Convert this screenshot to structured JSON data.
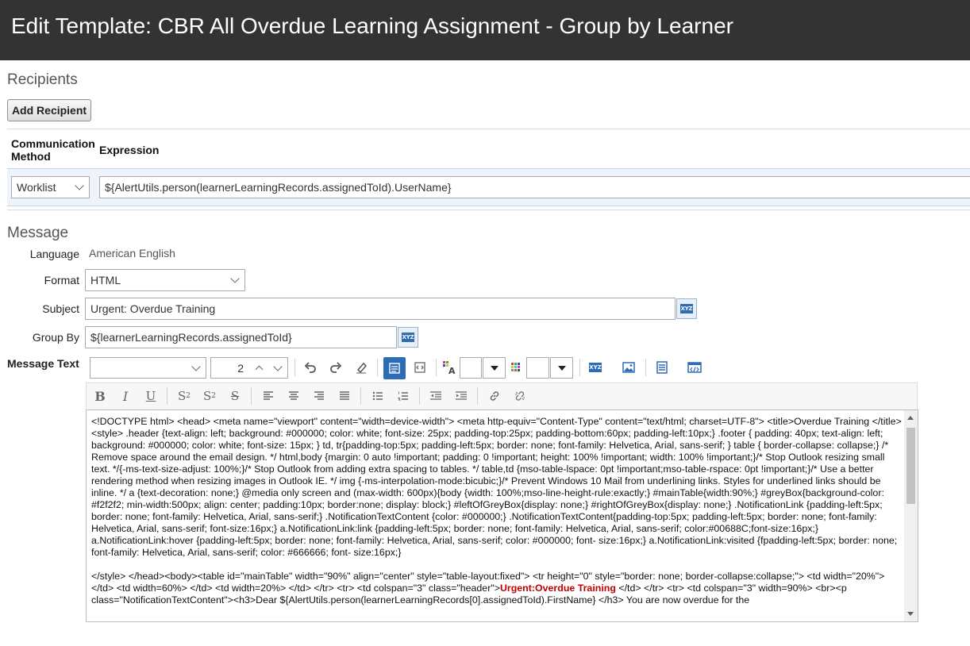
{
  "window": {
    "title": "Edit Template: CBR All Overdue Learning Assignment - Group by Learner"
  },
  "recipients": {
    "section_title": "Recipients",
    "add_button": "Add Recipient",
    "columns": {
      "method_line1": "Communication",
      "method_line2": "Method",
      "expression": "Expression"
    },
    "row": {
      "method": "Worklist",
      "expression": "${AlertUtils.person(learnerLearningRecords.assignedToId).UserName}"
    }
  },
  "message": {
    "section_title": "Message",
    "language_label": "Language",
    "language_value": "American English",
    "format_label": "Format",
    "format_value": "HTML",
    "subject_label": "Subject",
    "subject_value": "Urgent: Overdue Training",
    "groupby_label": "Group By",
    "groupby_value": "${learnerLearningRecords.assignedToId}",
    "message_text_label": "Message Text",
    "font_size_value": "2",
    "xyz_icon_text": "XYZ",
    "body_paragraph1": "<!DOCTYPE html> <head> <meta name=\"viewport\" content=\"width=device-width\"> <meta http-equiv=\"Content-Type\" content=\"text/html; charset=UTF-8\"> <title>Overdue Training </title> <style> .header {text-align: left; background: #000000; color: white; font-size: 25px; padding-top:25px; padding-bottom:60px; padding-left:10px;} .footer { padding: 40px; text-align: left; background: #000000; color: white; font-size: 15px; } td, tr{padding-top:5px; padding-left:5px; border: none; font-family: Helvetica, Arial, sans-serif; } table { border-collapse: collapse;} /* Remove space around the email design. */ html,body {margin: 0 auto !important; padding: 0 !important; height: 100% !important; width: 100% !important;}/* Stop Outlook resizing small text. */{-ms-text-size-adjust: 100%;}/* Stop Outlook from adding extra spacing to tables. */ table,td {mso-table-lspace: 0pt !important;mso-table-rspace: 0pt !important;}/* Use a better rendering method when resizing images in Outlook IE. */ img {-ms-interpolation-mode:bicubic;}/* Prevent Windows 10 Mail from underlining links. Styles for underlined links should be inline. */ a {text-decoration: none;} @media only screen and (max-width: 600px){body {width: 100%;mso-line-height-rule:exactly;} #mainTable{width:90%;} #greyBox{background-color: #f2f2f2; min-width:500px; align: center; padding:10px; border:none; display: block;} #leftOfGreyBox{display: none;} #rightOfGreyBox{display: none;} .NotificationLink {padding-left:5px; border: none; font-family: Helvetica, Arial, sans-serif;} .NotificationTextContent {color: #000000;} .NotificationTextContent{padding-top:5px; padding-left:5px; border: none; font-family: Helvetica, Arial, sans-serif; font-size:16px;} a.NotificationLink:link {padding-left:5px; border: none; font-family: Helvetica, Arial, sans-serif; color:#00688C;font-size:16px;} a.NotificationLink:hover {padding-left:5px; border: none; font-family: Helvetica, Arial, sans-serif; color: #000000; font- size:16px;} a.NotificationLink:visited {fpadding-left:5px; border: none; font-family: Helvetica, Arial, sans-serif; color: #666666; font- size:16px;}",
    "body_p2_part1": "</style> </head><body><table id=\"mainTable\" width=\"90%\" align=\"center\" style=\"table-layout:fixed\"> <tr height=\"0\" style=\"border: none; border-collapse:collapse;\"> <td width=\"20%\"> </td> <td width=60%> </td> <td width=20%> </td> </tr> <tr> <td colspan=\"3\" class=\"header\">",
    "body_p2_urgent": "Urgent:Overdue Training",
    "body_p2_part2": " </td> </tr>  <tr> <td colspan=\"3\" width=90%> <br><p class=\"NotificationTextContent\"><h3>Dear ${AlertUtils.person(learnerLearningRecords[0].assignedToId).FirstName} </h3> You are now overdue for the"
  }
}
